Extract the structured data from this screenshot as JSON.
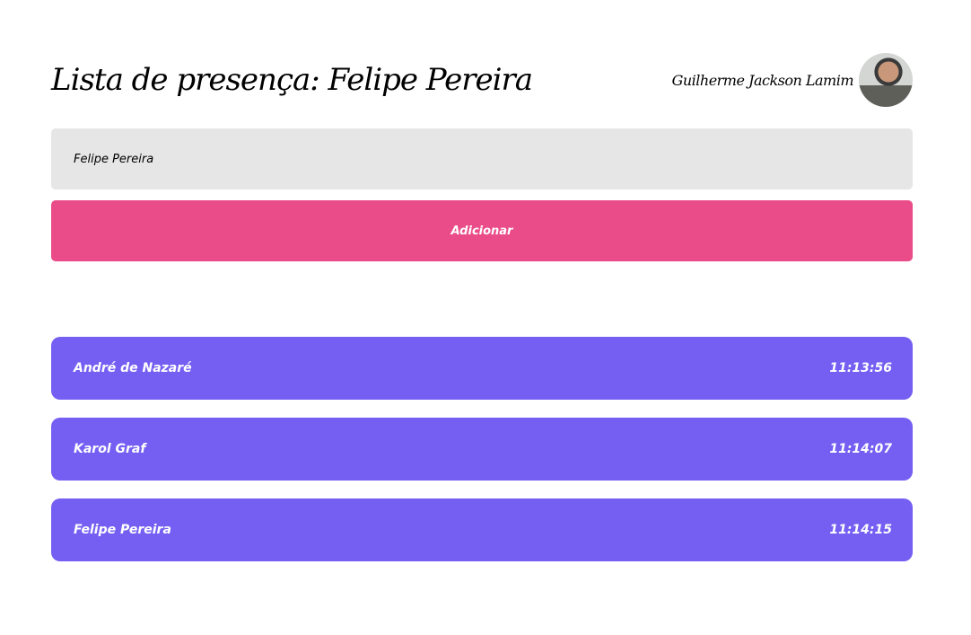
{
  "header": {
    "title": "Lista de presença: Felipe Pereira",
    "user_name": "Guilherme Jackson Lamim"
  },
  "form": {
    "input_value": "Felipe Pereira",
    "button_label": "Adicionar"
  },
  "attendees": [
    {
      "name": "André de Nazaré",
      "time": "11:13:56"
    },
    {
      "name": "Karol Graf",
      "time": "11:14:07"
    },
    {
      "name": "Felipe Pereira",
      "time": "11:14:15"
    }
  ],
  "colors": {
    "button": "#ea4c89",
    "card": "#755ef2",
    "input": "#e6e6e6"
  }
}
